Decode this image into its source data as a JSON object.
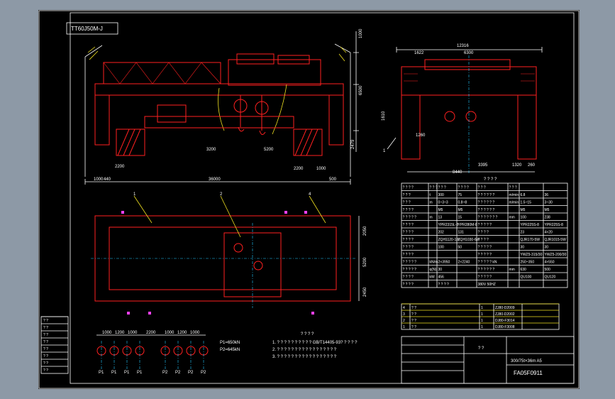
{
  "drawing": {
    "stamp_top_left": "TT60J50M-J",
    "title_block": {
      "model": "300/75t×36m A5",
      "drawing_no": "FA05F0911",
      "title_mark": "? ?"
    },
    "notes": {
      "heading": "? ? ? ?",
      "lines": [
        "1. ? ? ? ? ? ? ? ? ? ? GB/T14405-93? ? ? ? ?",
        "2. ? ? ? ? ? ? ? ? ? ? ? ? ? ? ? ? ?",
        "3. ? ? ? ? ? ? ? ? ? ? ? ? ? ? ? ? ?"
      ]
    },
    "loads": {
      "p1": "P1=650kN",
      "p2": "P2=645kN"
    },
    "dimensions": {
      "front": [
        "36000",
        "2200",
        "1000",
        "440",
        "500",
        "1000",
        "2200",
        "2479",
        "3200",
        "6500",
        "5200",
        "1000"
      ],
      "side": [
        "12316",
        "1622",
        "6300",
        "3395",
        "1320",
        "260",
        "1260",
        "8440",
        "1610"
      ],
      "plan": [
        "2050",
        "5200",
        "2450"
      ],
      "wheel": [
        "1000",
        "1200",
        "1000",
        "2200",
        "1000",
        "1200",
        "1000"
      ]
    },
    "wheel_labels": [
      "P1",
      "P1",
      "P1",
      "P1",
      "P2",
      "P2",
      "P2",
      "P2"
    ],
    "part_labels": [
      "1",
      "2",
      "4",
      "1"
    ],
    "spec_table": {
      "headers": [
        "? ? ? ?",
        "? ? ?",
        "? ? ?",
        "? ? ? ?",
        "? ? ?",
        "? ? ?"
      ],
      "rows": [
        [
          "? ? ?",
          "t",
          "300",
          "75",
          "? ? ? ? ? ?",
          "m/min",
          "6.8",
          "36"
        ],
        [
          "? ? ?",
          "m",
          "0~3~3",
          "0.8~8",
          "? ? ? ? ? ?",
          "m/min",
          "1.5~15",
          "3~30"
        ],
        [
          "? ? ? ?",
          "",
          "M5",
          "M5",
          "? ? ? ? ? ?",
          "",
          "M5",
          "M5"
        ],
        [
          "? ? ? ? ?",
          "m",
          "13",
          "15",
          "? ? ? ? ? ? ?",
          "mm",
          "100",
          "238"
        ],
        [
          "? ? ? ?",
          "",
          "YPR2315L-8",
          "YPR280M-8",
          "? ? ? ? ?",
          "",
          "YPR225S-8",
          "YPR225S-8"
        ],
        [
          "? ? ? ?",
          "",
          "202",
          "131",
          "? ? ? ?",
          "",
          "23",
          "4×20"
        ],
        [
          "? ? ? ?",
          "",
          "ZQH1120-1W",
          "ZQH1030-6W",
          "? ? ? ?",
          "",
          "QJR170-5W",
          "QJR1015-5W"
        ],
        [
          "? ? ? ?",
          "",
          "100",
          "50",
          "? ? ? ? ?",
          "",
          "30",
          "30"
        ],
        [
          "? ? ? ?",
          "",
          "",
          "",
          "? ? ? ? ?",
          "",
          "YWZ5-315/30",
          "YWZ5-200/30"
        ],
        [
          "? ? ? ? ?",
          "kN/m",
          "2×3950",
          "2×2240",
          "? ? ? ? ? kN",
          "",
          "250~350",
          "4×550"
        ],
        [
          "? ? ? ? ?",
          "q(N)",
          "30",
          "",
          "? ? ? ? ? ?",
          "mm",
          "630",
          "500"
        ],
        [
          "? ? ? ?",
          "kW",
          "456",
          "",
          "? ? ? ? ?",
          "",
          "QU100",
          "QU120"
        ],
        [
          "? ? ? ?",
          "",
          "? ? ? ?",
          "",
          "380V 50HZ",
          "",
          "",
          ""
        ]
      ],
      "caption": "? ? ? ?"
    },
    "parts_list": {
      "rows": [
        [
          "4",
          "? ?",
          "1",
          "ZJ80-D2009"
        ],
        [
          "3",
          "? ?",
          "1",
          "ZJ80-D2002"
        ],
        [
          "2",
          "? ?",
          "1",
          "DJ80-F3014"
        ],
        [
          "1",
          "? ?",
          "1",
          "DJ80-F3008"
        ]
      ]
    },
    "revision_block": [
      "? ?",
      "? ?",
      "? ?",
      "? ?",
      "? ?",
      "? ?",
      "? ?",
      "? ?"
    ]
  }
}
